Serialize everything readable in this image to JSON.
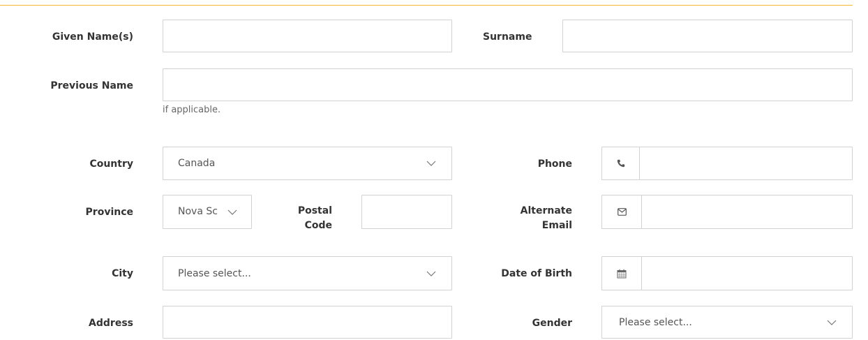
{
  "theme": {
    "accent": "#f5b730",
    "border": "#d2d2d2"
  },
  "form": {
    "given_names": {
      "label": "Given Name(s)",
      "value": ""
    },
    "surname": {
      "label": "Surname",
      "value": ""
    },
    "previous_name": {
      "label": "Previous Name",
      "value": "",
      "help": "if applicable."
    },
    "country": {
      "label": "Country",
      "selected": "Canada",
      "icon": "chevron-down-icon"
    },
    "phone": {
      "label": "Phone",
      "value": "",
      "icon": "phone-icon"
    },
    "province": {
      "label": "Province",
      "selected": "Nova Sc",
      "icon": "chevron-down-icon"
    },
    "postal_code": {
      "label": "Postal Code",
      "value": ""
    },
    "alternate_email": {
      "label": "Alternate Email",
      "value": "",
      "icon": "envelope-icon"
    },
    "city": {
      "label": "City",
      "selected": "Please select...",
      "icon": "chevron-down-icon"
    },
    "date_of_birth": {
      "label": "Date of Birth",
      "value": "",
      "icon": "calendar-icon"
    },
    "address": {
      "label": "Address",
      "value": ""
    },
    "gender": {
      "label": "Gender",
      "selected": "Please select...",
      "icon": "chevron-down-icon"
    }
  }
}
